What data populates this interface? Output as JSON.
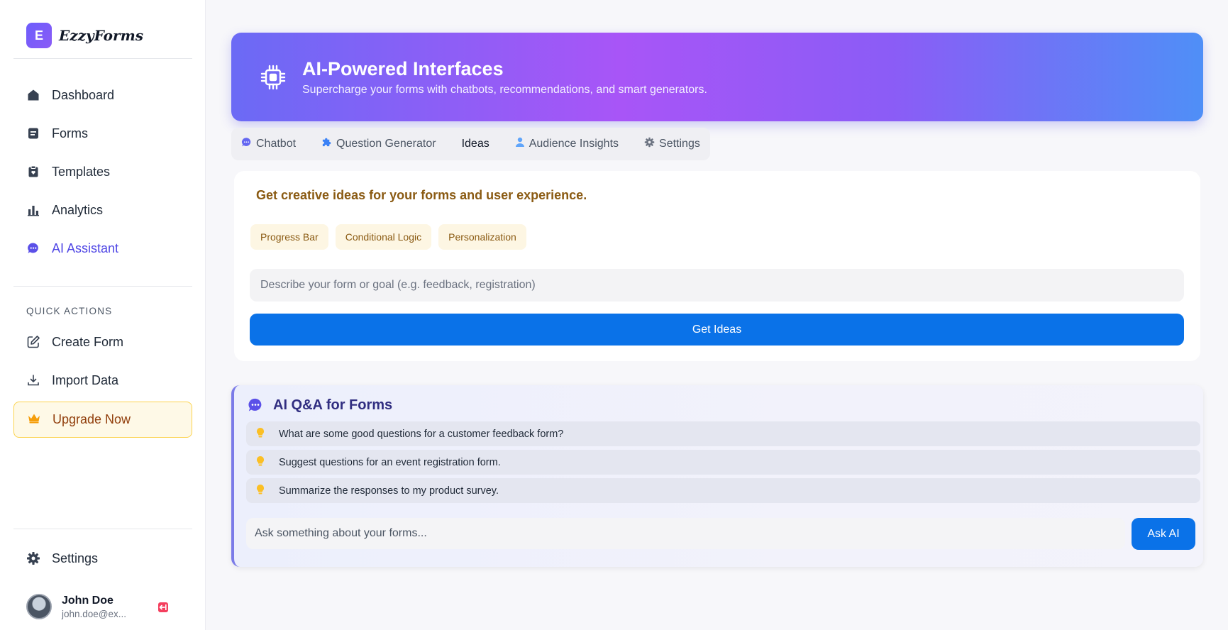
{
  "brand": {
    "logo_letter": "E",
    "name": "EzzyForms"
  },
  "sidebar": {
    "nav": [
      {
        "label": "Dashboard",
        "icon": "home-icon"
      },
      {
        "label": "Forms",
        "icon": "forms-icon"
      },
      {
        "label": "Templates",
        "icon": "templates-icon"
      },
      {
        "label": "Analytics",
        "icon": "analytics-icon"
      },
      {
        "label": "AI Assistant",
        "icon": "chat-icon",
        "active": true
      }
    ],
    "quick_actions_label": "QUICK ACTIONS",
    "quick_actions": [
      {
        "label": "Create Form",
        "icon": "edit-icon"
      },
      {
        "label": "Import Data",
        "icon": "download-icon"
      }
    ],
    "upgrade_label": "Upgrade Now",
    "settings_label": "Settings"
  },
  "user": {
    "name": "John Doe",
    "email": "john.doe@ex..."
  },
  "hero": {
    "title": "AI-Powered Interfaces",
    "subtitle": "Supercharge your forms with chatbots, recommendations, and smart generators."
  },
  "tabs": [
    {
      "label": "Chatbot",
      "icon": "chat-icon"
    },
    {
      "label": "Question Generator",
      "icon": "puzzle-icon"
    },
    {
      "label": "Ideas",
      "icon": "",
      "active": true
    },
    {
      "label": "Audience Insights",
      "icon": "user-icon"
    },
    {
      "label": "Settings",
      "icon": "gear-icon"
    }
  ],
  "ideas": {
    "heading": "Get creative ideas for your forms and user experience.",
    "chips": [
      "Progress Bar",
      "Conditional Logic",
      "Personalization"
    ],
    "input_placeholder": "Describe your form or goal (e.g. feedback, registration)",
    "button_label": "Get Ideas"
  },
  "qa": {
    "title": "AI Q&A for Forms",
    "suggestions": [
      "What are some good questions for a customer feedback form?",
      "Suggest questions for an event registration form.",
      "Summarize the responses to my product survey."
    ],
    "input_placeholder": "Ask something about your forms...",
    "button_label": "Ask AI"
  },
  "colors": {
    "accent": "#4f46e5",
    "primary_button": "#0a72e8",
    "upgrade_text": "#92400e",
    "ideas_text": "#8a5a12"
  }
}
